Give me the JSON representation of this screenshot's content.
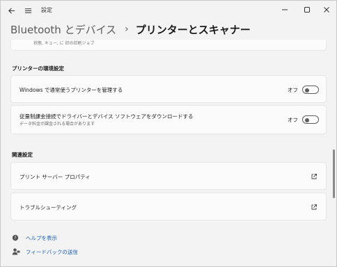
{
  "window": {
    "title": "設定"
  },
  "breadcrumb": {
    "parent": "Bluetooth とデバイス",
    "separator": "›",
    "current": "プリンターとスキャナー"
  },
  "partial": {
    "text": "状態, キュー, に 印の印刷ジョブ"
  },
  "printer_settings": {
    "title": "プリンターの環境設定",
    "items": [
      {
        "label": "Windows で通常使うプリンターを管理する",
        "state": "オフ"
      },
      {
        "label": "従量制課金接続でドライバーとデバイス ソフトウェアをダウンロードする",
        "sublabel": "データ料金が課金される場合があります",
        "state": "オフ"
      }
    ]
  },
  "related": {
    "title": "関連設定",
    "items": [
      {
        "label": "プリント サーバー プロパティ"
      },
      {
        "label": "トラブルシューティング"
      }
    ]
  },
  "help": {
    "get_help": "ヘルプを表示",
    "feedback": "フィードバックの送信"
  },
  "icons": {
    "back": "back-arrow-icon",
    "menu": "hamburger-menu-icon",
    "external": "open-external-icon",
    "help": "help-icon",
    "feedback": "feedback-icon"
  },
  "colors": {
    "link": "#1a5fb4",
    "toggle": "#5c5c5c"
  }
}
